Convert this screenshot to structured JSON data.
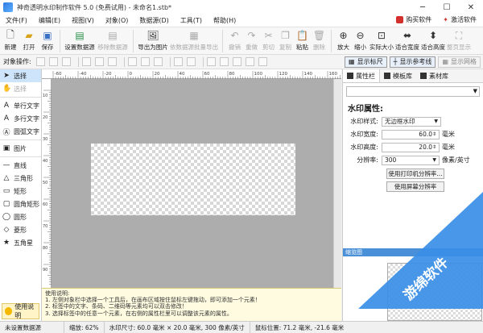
{
  "window": {
    "title": "神奇透明水印制作软件 5.0 (免费试用) - 未命名1.stb*"
  },
  "menu": {
    "items": [
      "文件(F)",
      "编辑(E)",
      "视图(V)",
      "对象(O)",
      "数据源(D)",
      "工具(T)",
      "帮助(H)"
    ],
    "buy": "购买软件",
    "activate": "激活软件"
  },
  "toolbar": {
    "new": "新建",
    "open": "打开",
    "save": "保存",
    "set_datasource": "设置数据源",
    "remove_datasource": "移除数据源",
    "export_image": "导出为图片",
    "batch_export": "依数据源批量导出",
    "undo": "撤销",
    "redo": "重做",
    "cut": "剪切",
    "copy": "复制",
    "paste": "粘贴",
    "delete": "删除",
    "zoom_in": "放大",
    "zoom_out": "缩小",
    "actual_size": "实际大小",
    "fit_width": "适合宽度",
    "fit_height": "适合高度",
    "whole_page": "整页显示"
  },
  "objbar": {
    "label": "对象操作:",
    "show_ruler": "显示标尺",
    "show_guides": "显示参考线",
    "show_grid": "显示网格"
  },
  "tools": {
    "select": "选择",
    "pan": "选择",
    "single_text": "单行文字",
    "multi_text": "多行文字",
    "arc_text": "圆弧文字",
    "image": "图片",
    "line": "直线",
    "triangle": "三角形",
    "rect": "矩形",
    "round_rect": "圆角矩形",
    "circle": "圆形",
    "diamond": "菱形",
    "star": "五角星",
    "help": "使用说明"
  },
  "help": {
    "title": "使用说明:",
    "lines": [
      "1. 左侧对象栏中选择一个工具后，在画布区域按住鼠标左键拖动，即可添加一个元素！",
      "2. 标签中的文字、条码、二维码等元素均可以双击修改！",
      "3. 选择标签中的任意一个元素，在右侧的属性栏里可以调整该元素的属性。"
    ]
  },
  "ruler": {
    "top": [
      "-60",
      "-40",
      "-20",
      "0",
      "20",
      "40",
      "60",
      "80",
      "100",
      "120",
      "140",
      "160"
    ],
    "left": [
      "10",
      "20",
      "30",
      "40",
      "50",
      "60",
      "70",
      "80",
      "90"
    ]
  },
  "panel": {
    "tabs": [
      "属性栏",
      "模板库",
      "素材库"
    ],
    "props_title": "水印属性:",
    "style_label": "水印样式:",
    "style_value": "无边框水印",
    "width_label": "水印宽度:",
    "width_value": "60.0",
    "width_unit": "毫米",
    "height_label": "水印高度:",
    "height_value": "20.0",
    "height_unit": "毫米",
    "res_label": "分辨率:",
    "res_value": "300",
    "res_unit": "像素/英寸",
    "btn_printer_res": "使用打印机分辨率...",
    "btn_screen_res": "使用屏幕分辨率",
    "thumb_title": "缩览图",
    "watermark_text": "游绵软件"
  },
  "status": {
    "datasource": "未设置数据源",
    "zoom": "缩放: 62%",
    "size": "水印尺寸: 60.0 毫米 × 20.0 毫米, 300 像素/英寸",
    "coords": "鼠标位置: 71.2 毫米, -21.6 毫米"
  }
}
